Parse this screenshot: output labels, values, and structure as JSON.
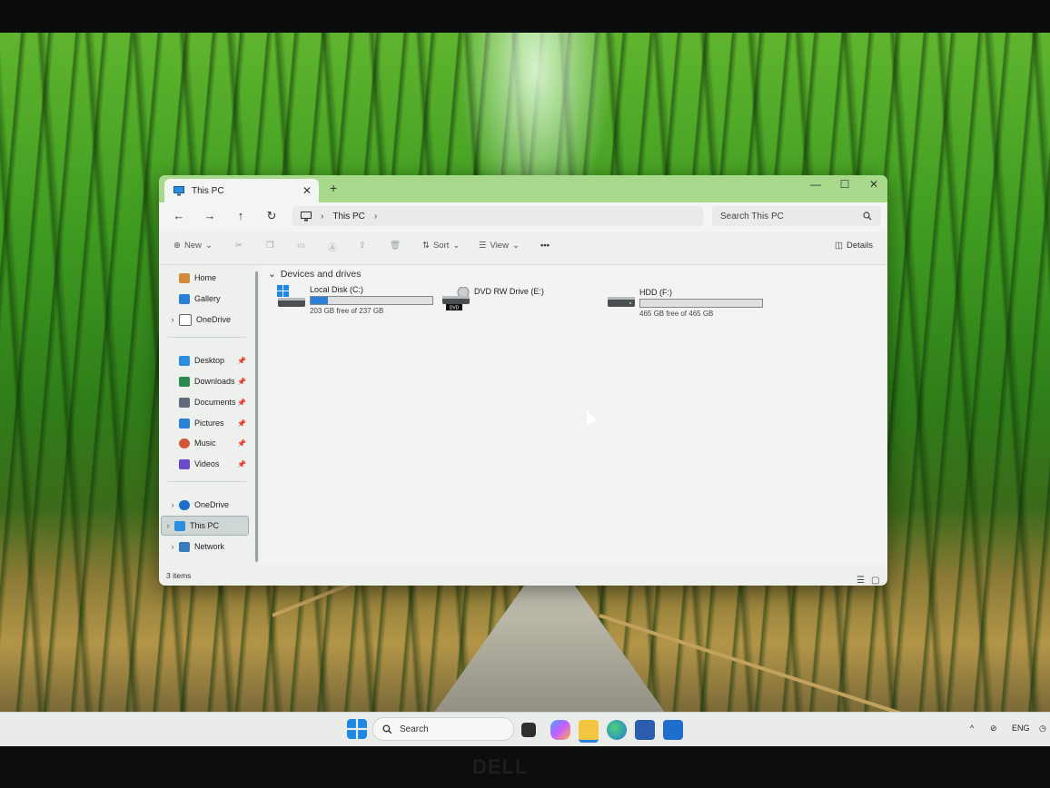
{
  "window": {
    "tab_title": "This PC",
    "new_tab": "+",
    "close_tab": "✕",
    "minimize": "—",
    "maximize": "☐",
    "close": "✕"
  },
  "nav": {
    "back": "←",
    "forward": "→",
    "up": "↑",
    "refresh": "↻",
    "breadcrumb": [
      "This PC"
    ],
    "search_placeholder": "Search This PC"
  },
  "toolbar": {
    "new_label": "New",
    "sort_label": "Sort",
    "view_label": "View",
    "more_label": "•••",
    "details_label": "Details"
  },
  "sidebar": {
    "top": [
      {
        "label": "Home",
        "icon": "home-icon"
      },
      {
        "label": "Gallery",
        "icon": "gallery-icon"
      },
      {
        "label": "OneDrive",
        "icon": "onedrive-icon"
      }
    ],
    "pinned": [
      {
        "label": "Desktop",
        "icon": "desktop-icon"
      },
      {
        "label": "Downloads",
        "icon": "download-icon"
      },
      {
        "label": "Documents",
        "icon": "documents-icon"
      },
      {
        "label": "Pictures",
        "icon": "pictures-icon"
      },
      {
        "label": "Music",
        "icon": "music-icon"
      },
      {
        "label": "Videos",
        "icon": "videos-icon"
      }
    ],
    "tree": [
      {
        "label": "OneDrive",
        "icon": "onedrive-icon"
      },
      {
        "label": "This PC",
        "icon": "pc-icon",
        "selected": true
      },
      {
        "label": "Network",
        "icon": "network-icon"
      }
    ]
  },
  "content": {
    "group_title": "Devices and drives",
    "drives": [
      {
        "name": "Local Disk (C:)",
        "free_text": "203 GB free of 237 GB",
        "used_fraction": 0.14
      },
      {
        "name": "DVD RW Drive (E:)",
        "badge": "DVD"
      },
      {
        "name": "HDD (F:)",
        "free_text": "465 GB free of 465 GB",
        "used_fraction": 0.0
      }
    ]
  },
  "status": {
    "items_count": "3 items"
  },
  "taskbar": {
    "search_label": "Search",
    "language": "ENG",
    "tray_chevron": "^"
  },
  "bezel_brand": "DELL",
  "colors": {
    "titlebar": "#a7d88c",
    "drive_bar_fill": "#2b7fd6",
    "selected_bg": "#cfd6d6"
  }
}
